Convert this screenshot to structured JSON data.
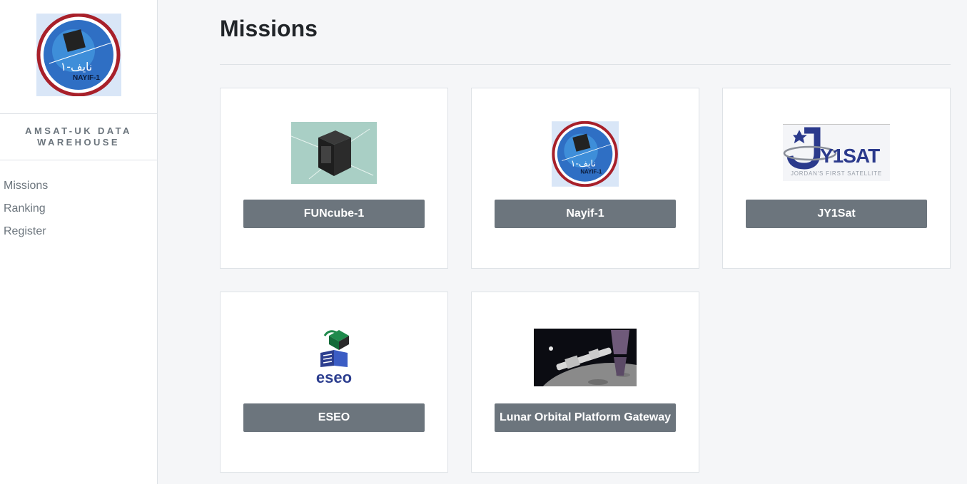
{
  "sidebar": {
    "brand": "AMSAT-UK DATA WAREHOUSE",
    "nav": [
      {
        "label": "Missions"
      },
      {
        "label": "Ranking"
      },
      {
        "label": "Register"
      }
    ]
  },
  "main": {
    "title": "Missions",
    "missions": [
      {
        "name": "FUNcube-1",
        "image": "funcube-satellite-photo"
      },
      {
        "name": "Nayif-1",
        "image": "nayif-1-mission-patch"
      },
      {
        "name": "JY1Sat",
        "image": "jy1sat-logo",
        "logo_text": "Y1SAT",
        "logo_subtext": "JORDAN'S FIRST SATELLITE"
      },
      {
        "name": "ESEO",
        "image": "eseo-logo",
        "logo_text": "eseo"
      },
      {
        "name": "Lunar Orbital Platform Gateway",
        "image": "lunar-gateway-render"
      }
    ]
  },
  "colors": {
    "button_bg": "#6c757d",
    "page_bg": "#f5f6f8",
    "jy1_blue": "#2b3a8c",
    "eseo_blue": "#2c3e8f",
    "eseo_green": "#1f8a4c"
  }
}
